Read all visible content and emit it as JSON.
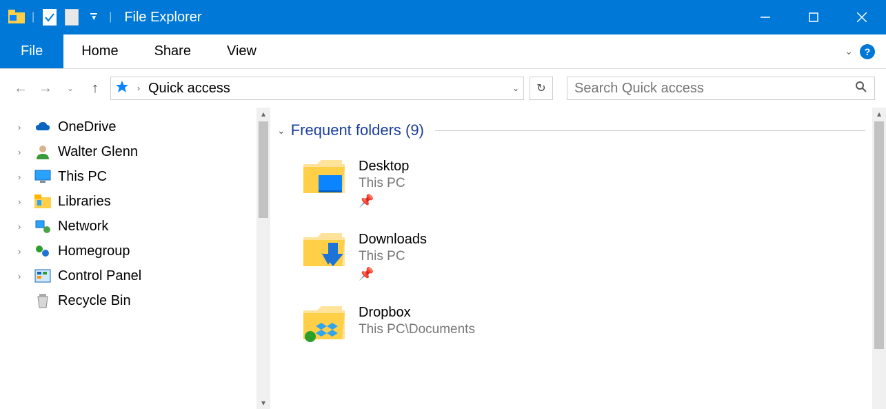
{
  "window": {
    "title": "File Explorer"
  },
  "ribbon": {
    "file": "File",
    "tabs": [
      "Home",
      "Share",
      "View"
    ]
  },
  "address": {
    "location": "Quick access"
  },
  "search": {
    "placeholder": "Search Quick access"
  },
  "tree": [
    {
      "label": "OneDrive",
      "icon": "onedrive",
      "expandable": true
    },
    {
      "label": "Walter Glenn",
      "icon": "user",
      "expandable": true
    },
    {
      "label": "This PC",
      "icon": "thispc",
      "expandable": true
    },
    {
      "label": "Libraries",
      "icon": "libraries",
      "expandable": true
    },
    {
      "label": "Network",
      "icon": "network",
      "expandable": true
    },
    {
      "label": "Homegroup",
      "icon": "homegroup",
      "expandable": true
    },
    {
      "label": "Control Panel",
      "icon": "controlpanel",
      "expandable": true
    },
    {
      "label": "Recycle Bin",
      "icon": "recyclebin",
      "expandable": false
    }
  ],
  "group": {
    "title": "Frequent folders",
    "count": 9
  },
  "folders": [
    {
      "name": "Desktop",
      "path": "This PC",
      "overlay": "desktop",
      "pinned": true
    },
    {
      "name": "Downloads",
      "path": "This PC",
      "overlay": "downloads",
      "pinned": true
    },
    {
      "name": "Dropbox",
      "path": "This PC\\Documents",
      "overlay": "dropbox",
      "pinned": false
    }
  ]
}
